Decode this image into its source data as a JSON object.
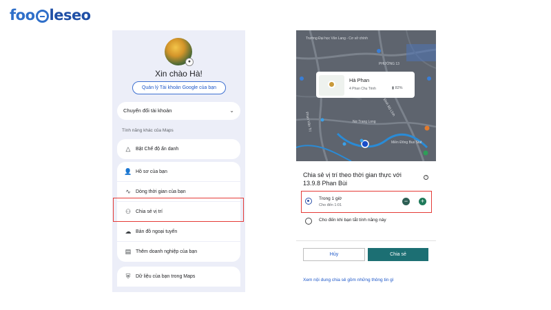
{
  "brand": {
    "logo_text_a": "foo",
    "logo_text_b": "leseo"
  },
  "left": {
    "greeting": "Xin chào Hà!",
    "manage_account": "Quản lý Tài khoản Google của bạn",
    "switch_account": "Chuyển đổi tài khoản",
    "section_label": "Tính năng khác của Maps",
    "incognito": "Bật Chế độ ẩn danh",
    "menu": [
      {
        "label": "Hồ sơ của bạn",
        "icon": "profile-icon"
      },
      {
        "label": "Dòng thời gian của bạn",
        "icon": "timeline-icon"
      },
      {
        "label": "Chia sẻ vị trí",
        "icon": "location-sharing-icon"
      },
      {
        "label": "Bản đồ ngoại tuyến",
        "icon": "offline-map-icon"
      },
      {
        "label": "Thêm doanh nghiệp của bạn",
        "icon": "add-business-icon"
      }
    ],
    "data_item": "Dữ liệu của bạn trong Maps"
  },
  "map": {
    "labels": {
      "school": "Trường Đại học Văn Lang - Cơ sở chính",
      "ward": "PHƯỜNG 13",
      "street1": "Phan Văn Trị",
      "street2": "Phan Văn Trị",
      "street3": "Nơ Trang Long",
      "street4": "Đinh Bộ Lĩnh",
      "station": "Miền Đông Bus Stat"
    },
    "place_name": "Hà Phan",
    "place_address": "4 Phan Chu Trinh",
    "battery": "82%"
  },
  "share": {
    "title": "Chia sẻ vị trí theo thời gian thực với 13.9.8 Phan Bùi",
    "option1_main": "Trong 1 giờ",
    "option1_sub": "Cho đến 1:01",
    "option2_main": "Cho đến khi bạn tắt tính năng này",
    "cancel": "Hủy",
    "share": "Chia sẻ",
    "see_what": "Xem nội dung chia sẻ gồm những thông tin gì"
  },
  "colors": {
    "highlight": "#e53935",
    "primary_button": "#1c6f73",
    "link": "#1a55c8"
  }
}
